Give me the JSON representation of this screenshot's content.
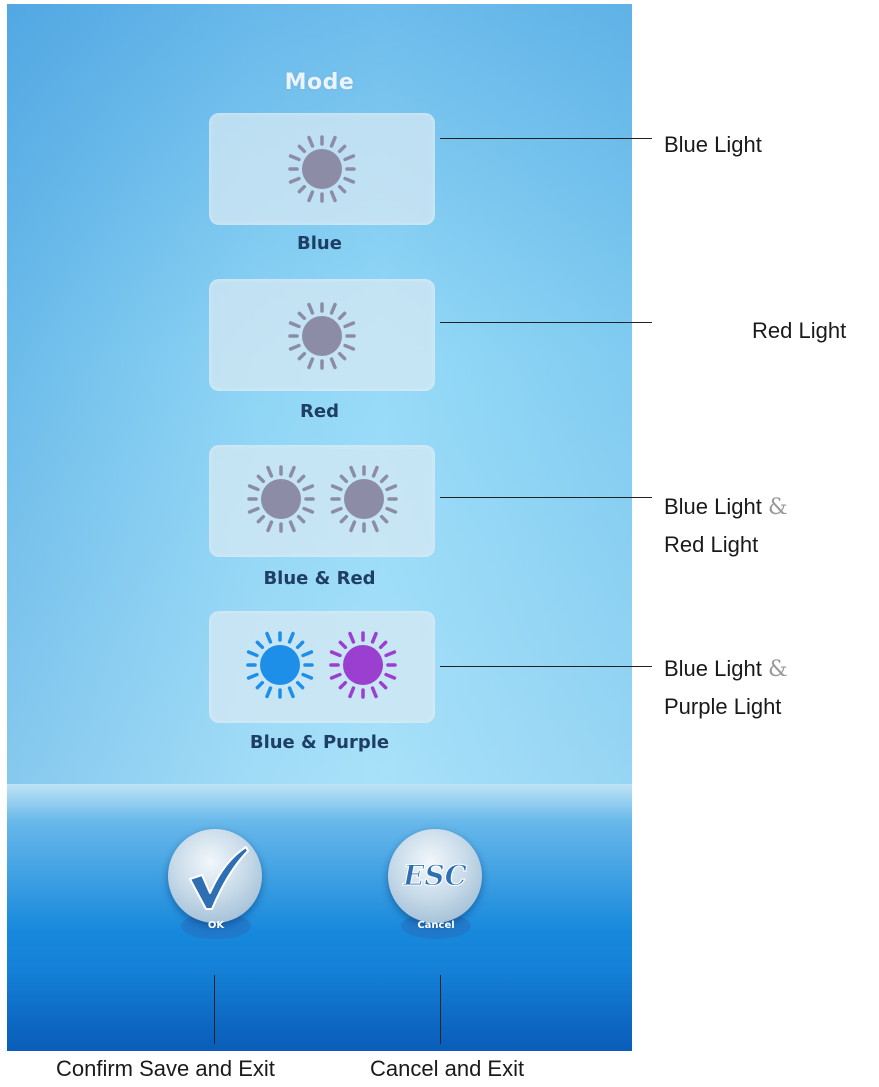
{
  "screen": {
    "title": "Mode",
    "modes": [
      {
        "label": "Blue",
        "icons": [
          "sun-icon"
        ],
        "icon_color": "#8c8ca6"
      },
      {
        "label": "Red",
        "icons": [
          "sun-icon"
        ],
        "icon_color": "#8c8ca6"
      },
      {
        "label": "Blue & Red",
        "icons": [
          "sun-icon",
          "sun-icon"
        ],
        "icon_color": "#8c8ca6"
      },
      {
        "label": "Blue & Purple",
        "icons": [
          "sun-icon",
          "sun-icon"
        ],
        "icon_colors": [
          "#1d8fe8",
          "#9b3fd1"
        ]
      }
    ],
    "ok_button": {
      "icon": "checkmark-icon",
      "label": "OK"
    },
    "cancel_button": {
      "icon": "esc-icon",
      "label": "Cancel"
    }
  },
  "callouts": {
    "blue": "Blue Light",
    "red": "Red Light",
    "blue_red_line1": "Blue Light",
    "blue_red_amp": "&",
    "blue_red_line2": "Red Light",
    "blue_purple_line1": "Blue Light",
    "blue_purple_amp": "&",
    "blue_purple_line2": "Purple Light",
    "ok": "Confirm Save and Exit",
    "cancel": "Cancel and Exit"
  },
  "colors": {
    "screen_blue": "#63b6e8",
    "bottom_blue": "#1789dc",
    "label_text": "#1e3e63"
  }
}
